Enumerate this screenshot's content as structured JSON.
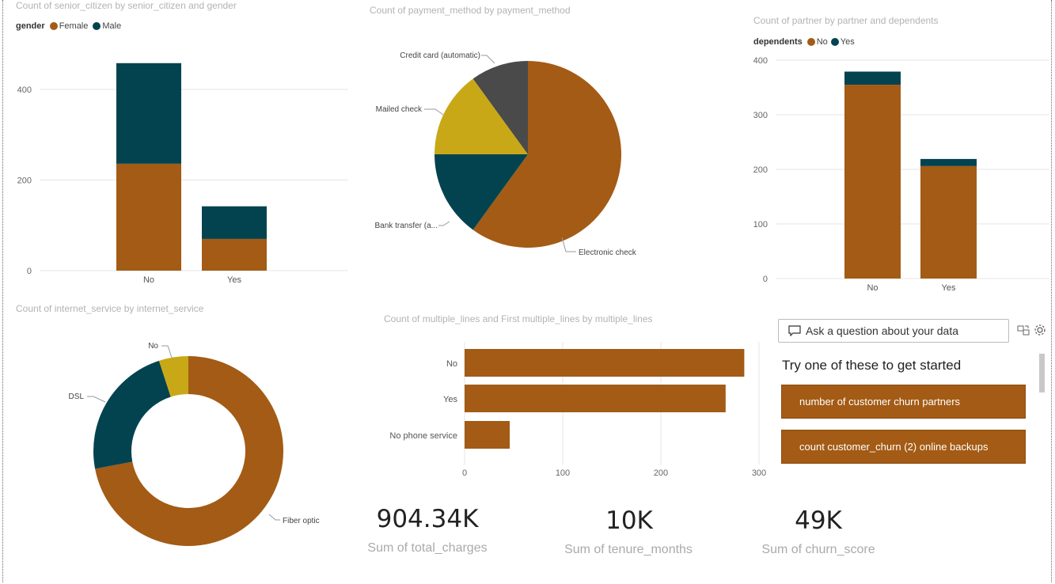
{
  "colors": {
    "brown": "#a35b15",
    "teal": "#03434f",
    "gold": "#c9a818",
    "gray": "#4a4a4a"
  },
  "charts": {
    "senior": {
      "title": "Count of senior_citizen by senior_citizen and gender",
      "legend_title": "gender",
      "legend": [
        "Female",
        "Male"
      ],
      "yticks": [
        "0",
        "200",
        "400"
      ]
    },
    "payment": {
      "title": "Count of payment_method by payment_method"
    },
    "partner": {
      "title": "Count of partner by partner and dependents",
      "legend_title": "dependents",
      "legend": [
        "No",
        "Yes"
      ],
      "yticks": [
        "0",
        "100",
        "200",
        "300",
        "400"
      ]
    },
    "internet": {
      "title": "Count of internet_service by internet_service"
    },
    "lines": {
      "title": "Count of multiple_lines and First multiple_lines by multiple_lines",
      "xticks": [
        "0",
        "100",
        "200",
        "300"
      ]
    }
  },
  "chart_data": [
    {
      "type": "bar",
      "title": "Count of senior_citizen by senior_citizen and gender",
      "categories": [
        "No",
        "Yes"
      ],
      "series": [
        {
          "name": "Female",
          "values": [
            236,
            70
          ]
        },
        {
          "name": "Male",
          "values": [
            222,
            72
          ]
        }
      ],
      "stacked": true,
      "ylim": [
        0,
        500
      ],
      "legend_position": "top-left"
    },
    {
      "type": "pie",
      "title": "Count of payment_method by payment_method",
      "labels": [
        "Electronic check",
        "Bank transfer (a...",
        "Mailed check",
        "Credit card (automatic)"
      ],
      "values": [
        60,
        15,
        15,
        10
      ]
    },
    {
      "type": "bar",
      "title": "Count of partner by partner and dependents",
      "categories": [
        "No",
        "Yes"
      ],
      "series": [
        {
          "name": "No",
          "values": [
            355,
            206
          ]
        },
        {
          "name": "Yes",
          "values": [
            24,
            13
          ]
        }
      ],
      "stacked": true,
      "ylim": [
        0,
        400
      ],
      "legend_position": "top-left"
    },
    {
      "type": "pie",
      "donut": true,
      "title": "Count of internet_service by internet_service",
      "labels": [
        "Fiber optic",
        "DSL",
        "No"
      ],
      "values": [
        72,
        23,
        5
      ]
    },
    {
      "type": "bar",
      "orientation": "horizontal",
      "title": "Count of multiple_lines and First multiple_lines by multiple_lines",
      "categories": [
        "No",
        "Yes",
        "No phone service"
      ],
      "values": [
        285,
        266,
        46
      ],
      "xlim": [
        0,
        300
      ]
    }
  ],
  "kpis": [
    {
      "value": "904.34K",
      "label": "Sum of total_charges"
    },
    {
      "value": "10K",
      "label": "Sum of tenure_months"
    },
    {
      "value": "49K",
      "label": "Sum of churn_score"
    }
  ],
  "qa": {
    "placeholder": "Ask a question about your data",
    "try_label": "Try one of these to get started",
    "suggestions": [
      "number of customer churn partners",
      "count customer_churn (2) online backups"
    ]
  }
}
